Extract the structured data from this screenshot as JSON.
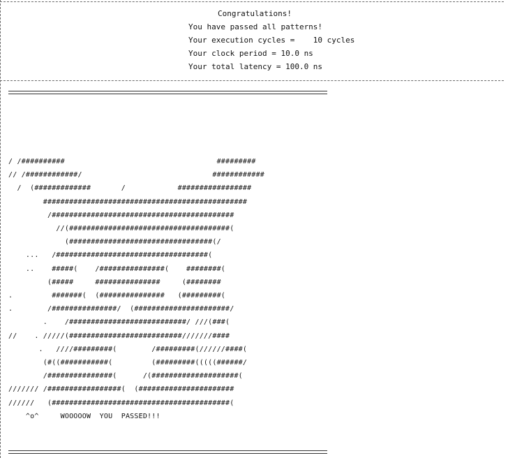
{
  "summary": {
    "title": "Congratulations!",
    "passed": "You have passed all patterns!",
    "cycles": "Your execution cycles =    10 cycles",
    "clock": "Your clock period = 10.0 ns",
    "latency": "Your total latency = 100.0 ns"
  },
  "art": {
    "lines": [
      "/ /##########                                   #########",
      "// /############/                              ############",
      "  /  (#############       /            #################",
      "        ###############################################",
      "         /##########################################",
      "           //(#####################################(",
      "             (#################################(/",
      "    ...   /###################################(",
      "    ..    #####(    /###############(    ########(",
      "         (#####     ###############     (########",
      ".         #######(  (###############   (#########(",
      ".        /###############/  (######################/",
      "        .    /###########################/ ///(###(",
      "//    . /////(##########################///////####",
      "       .   ////#########(        /#########(//////####(",
      "        (#((###########(         (#########(((((######/",
      "        /###############(      /(####################(",
      "/////// /#################(  (######################",
      "//////   (#########################################(",
      "    ^o^     WOOOOOW  YOU  PASSED!!!"
    ]
  }
}
